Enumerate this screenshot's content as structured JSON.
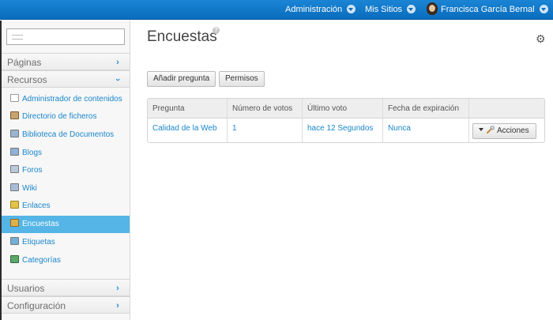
{
  "topbar": {
    "admin_label": "Administración",
    "sites_label": "Mis Sitios",
    "user_name": "Francisca García Bernal"
  },
  "sidebar": {
    "search_placeholder": "",
    "sections": [
      {
        "label": "Páginas",
        "state": "collapsed"
      },
      {
        "label": "Recursos",
        "state": "expanded"
      },
      {
        "label": "Usuarios",
        "state": "collapsed"
      },
      {
        "label": "Configuración",
        "state": "collapsed"
      }
    ],
    "items": [
      {
        "label": "Administrador de contenidos",
        "icon": "content-admin-icon"
      },
      {
        "label": "Directorio de ficheros",
        "icon": "file-directory-icon"
      },
      {
        "label": "Biblioteca de Documentos",
        "icon": "document-library-icon"
      },
      {
        "label": "Blogs",
        "icon": "blogs-icon"
      },
      {
        "label": "Foros",
        "icon": "forums-icon"
      },
      {
        "label": "Wiki",
        "icon": "wiki-icon"
      },
      {
        "label": "Enlaces",
        "icon": "links-icon"
      },
      {
        "label": "Encuestas",
        "icon": "polls-icon",
        "active": true
      },
      {
        "label": "Etiquetas",
        "icon": "tags-icon"
      },
      {
        "label": "Categorías",
        "icon": "categories-icon"
      }
    ]
  },
  "main": {
    "title": "Encuestas",
    "help_glyph": "?",
    "buttons": {
      "add_question": "Añadir pregunta",
      "permissions": "Permisos"
    },
    "table": {
      "headers": [
        "Pregunta",
        "Número de votos",
        "Último voto",
        "Fecha de expiración",
        ""
      ],
      "rows": [
        {
          "question": "Calidad de la Web",
          "votes": "1",
          "last_vote": "hace 12 Segundos",
          "expiration": "Nunca",
          "actions": "Acciones"
        }
      ]
    }
  },
  "colors": {
    "topbar": "#0a6dbd",
    "link": "#1a86cc",
    "active_nav": "#54b5e6"
  }
}
